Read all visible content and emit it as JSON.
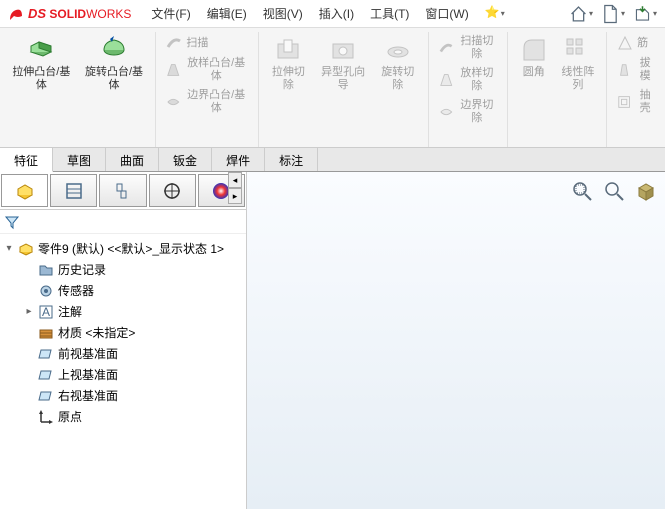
{
  "app": {
    "brand_ds": "DS",
    "brand_solid": "SOLID",
    "brand_works": "WORKS"
  },
  "menu": {
    "file": "文件(F)",
    "edit": "编辑(E)",
    "view": "视图(V)",
    "insert": "插入(I)",
    "tools": "工具(T)",
    "window": "窗口(W)"
  },
  "ribbon": {
    "extrude": "拉伸凸台/基体",
    "revolve": "旋转凸台/基体",
    "sweep": "扫描",
    "loft": "放样凸台/基体",
    "boundary": "边界凸台/基体",
    "extrude_cut": "拉伸切除",
    "hole": "异型孔向导",
    "revolve_cut": "旋转切除",
    "sweep_cut": "扫描切除",
    "loft_cut": "放样切除",
    "boundary_cut": "边界切除",
    "fillet": "圆角",
    "pattern": "线性阵列",
    "rib": "筋",
    "draft": "拔模",
    "shell": "抽壳"
  },
  "tabs": {
    "feature": "特征",
    "sketch": "草图",
    "surface": "曲面",
    "sheetmetal": "钣金",
    "weld": "焊件",
    "annotate": "标注"
  },
  "tree": {
    "root": "零件9 (默认) <<默认>_显示状态 1>",
    "history": "历史记录",
    "sensors": "传感器",
    "annotations": "注解",
    "material": "材质 <未指定>",
    "front": "前视基准面",
    "top": "上视基准面",
    "right": "右视基准面",
    "origin": "原点"
  }
}
